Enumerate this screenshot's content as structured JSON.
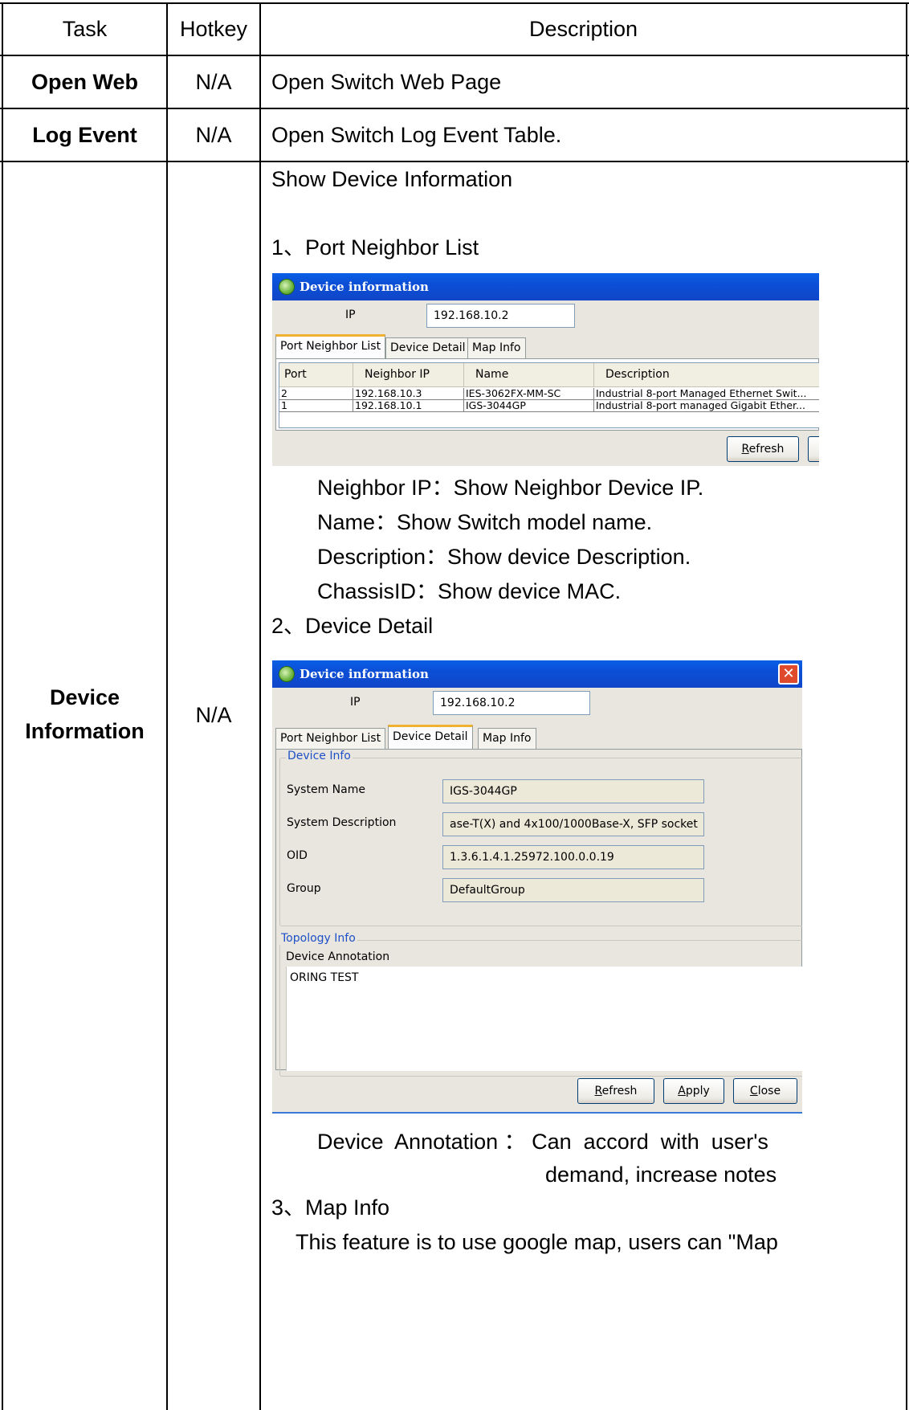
{
  "table": {
    "headers": {
      "task": "Task",
      "hotkey": "Hotkey",
      "description": "Description"
    },
    "rows": [
      {
        "task": "Open Web",
        "hotkey": "N/A",
        "description": "Open Switch Web Page"
      },
      {
        "task": "Log Event",
        "hotkey": "N/A",
        "description": "Open Switch Log Event Table."
      },
      {
        "task_line1": "Device",
        "task_line2": "Information",
        "hotkey": "N/A",
        "description": "Show Device Information",
        "item1": "1、Port Neighbor List",
        "item1_notes": [
          "Neighbor IP：Show Neighbor Device IP.",
          "Name：Show Switch model name.",
          "Description：Show device Description.",
          "ChassisID：Show device MAC."
        ],
        "item2": "2、Device Detail",
        "item2_note_line1": "Device  Annotation ： Can  accord  with  user's",
        "item2_note_line2": "demand, increase notes",
        "item3": "3、Map Info",
        "item3_text": "This feature is to use google map, users can \"Map"
      }
    ]
  },
  "dialog1": {
    "title": "Device information",
    "ip_label": "IP",
    "ip_value": "192.168.10.2",
    "tabs": [
      "Port Neighbor List",
      "Device Detail",
      "Map Info"
    ],
    "active_tab": "Port Neighbor List",
    "columns": [
      "Port",
      "Neighbor IP",
      "Name",
      "Description"
    ],
    "rows": [
      [
        "2",
        "192.168.10.3",
        "IES-3062FX-MM-SC",
        "Industrial 8-port Managed Ethernet Swit..."
      ],
      [
        "1",
        "192.168.10.1",
        "IGS-3044GP",
        "Industrial 8-port managed Gigabit Ether..."
      ]
    ],
    "refresh_button": "Refresh"
  },
  "dialog2": {
    "title": "Device information",
    "ip_label": "IP",
    "ip_value": "192.168.10.2",
    "tabs": [
      "Port Neighbor List",
      "Device Detail",
      "Map Info"
    ],
    "active_tab": "Device Detail",
    "device_info_title": "Device Info",
    "fields": [
      {
        "label": "System Name",
        "value": "IGS-3044GP"
      },
      {
        "label": "System Description",
        "value": "ase-T(X) and 4x100/1000Base-X, SFP socket"
      },
      {
        "label": "OID",
        "value": "1.3.6.1.4.1.25972.100.0.0.19"
      },
      {
        "label": "Group",
        "value": "DefaultGroup"
      }
    ],
    "topology_title": "Topology Info",
    "annotation_label": "Device Annotation",
    "annotation_value": "ORING TEST",
    "buttons": {
      "refresh": "Refresh",
      "apply": "Apply",
      "close": "Close"
    }
  },
  "colors": {
    "titlebar": "#0b4fd6",
    "dialog_bg": "#e8e6de",
    "group_label": "#1e50c8",
    "close_x": "#e04a2c"
  }
}
